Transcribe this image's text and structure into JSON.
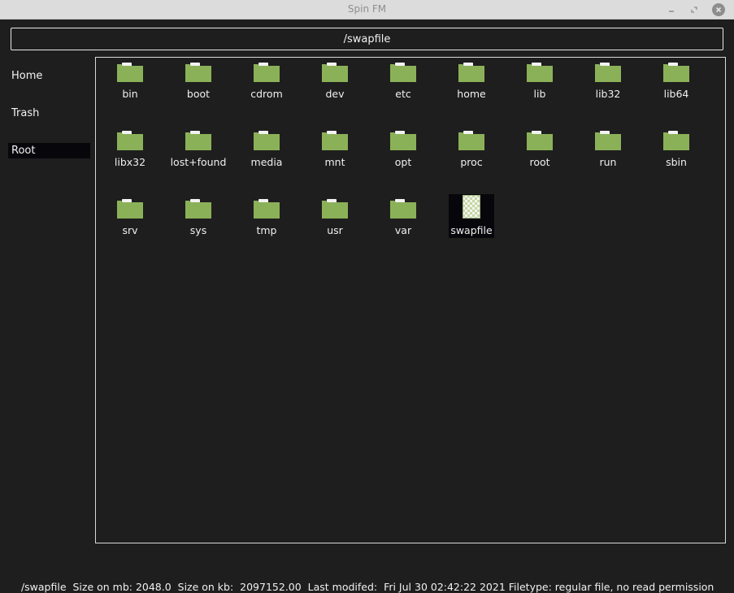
{
  "window": {
    "title": "Spin FM"
  },
  "pathbar": {
    "path": "/swapfile"
  },
  "sidebar": {
    "items": [
      {
        "label": "Home",
        "selected": false
      },
      {
        "label": "Trash",
        "selected": false
      },
      {
        "label": "Root",
        "selected": true
      }
    ]
  },
  "files": {
    "items": [
      {
        "name": "bin",
        "kind": "folder"
      },
      {
        "name": "boot",
        "kind": "folder"
      },
      {
        "name": "cdrom",
        "kind": "folder"
      },
      {
        "name": "dev",
        "kind": "folder"
      },
      {
        "name": "etc",
        "kind": "folder"
      },
      {
        "name": "home",
        "kind": "folder"
      },
      {
        "name": "lib",
        "kind": "folder"
      },
      {
        "name": "lib32",
        "kind": "folder"
      },
      {
        "name": "lib64",
        "kind": "folder"
      },
      {
        "name": "libx32",
        "kind": "folder"
      },
      {
        "name": "lost+found",
        "kind": "folder"
      },
      {
        "name": "media",
        "kind": "folder"
      },
      {
        "name": "mnt",
        "kind": "folder"
      },
      {
        "name": "opt",
        "kind": "folder"
      },
      {
        "name": "proc",
        "kind": "folder"
      },
      {
        "name": "root",
        "kind": "folder"
      },
      {
        "name": "run",
        "kind": "folder"
      },
      {
        "name": "sbin",
        "kind": "folder"
      },
      {
        "name": "srv",
        "kind": "folder"
      },
      {
        "name": "sys",
        "kind": "folder"
      },
      {
        "name": "tmp",
        "kind": "folder"
      },
      {
        "name": "usr",
        "kind": "folder"
      },
      {
        "name": "var",
        "kind": "folder"
      },
      {
        "name": "swapfile",
        "kind": "file",
        "selected": true
      }
    ]
  },
  "status": {
    "text": "/swapfile  Size on mb: 2048.0  Size on kb:  2097152.00  Last modifed:  Fri Jul 30 02:42:22 2021 Filetype: regular file, no read permission"
  },
  "colors": {
    "folder": "#8bb158",
    "folder_tab": "#f2f2f2",
    "background": "#1e1e1e",
    "selection": "#07070b"
  }
}
